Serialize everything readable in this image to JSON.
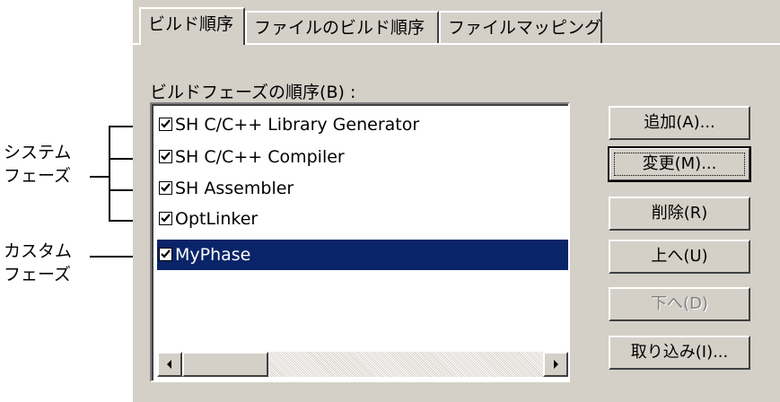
{
  "tabs": [
    {
      "label": "ビルド順序",
      "active": true
    },
    {
      "label": "ファイルのビルド順序",
      "active": false
    },
    {
      "label": "ファイルマッピング",
      "active": false
    }
  ],
  "phase_order_label": "ビルドフェーズの順序(B) :",
  "phases": [
    {
      "label": "SH C/C++ Library Generator",
      "checked": true,
      "selected": false
    },
    {
      "label": "SH C/C++ Compiler",
      "checked": true,
      "selected": false
    },
    {
      "label": "SH Assembler",
      "checked": true,
      "selected": false
    },
    {
      "label": "OptLinker",
      "checked": true,
      "selected": false
    },
    {
      "label": "MyPhase",
      "checked": true,
      "selected": true
    }
  ],
  "buttons": {
    "add": "追加(A)...",
    "modify": "変更(M)...",
    "remove": "削除(R)",
    "up": "上へ(U)",
    "down": "下へ(D)",
    "import": "取り込み(I)..."
  },
  "annotations": {
    "system_line1": "システム",
    "system_line2": "フェーズ",
    "custom_line1": "カスタム",
    "custom_line2": "フェーズ"
  },
  "colors": {
    "selection": "#0a246a",
    "dialog_bg": "#d4d0c8"
  }
}
